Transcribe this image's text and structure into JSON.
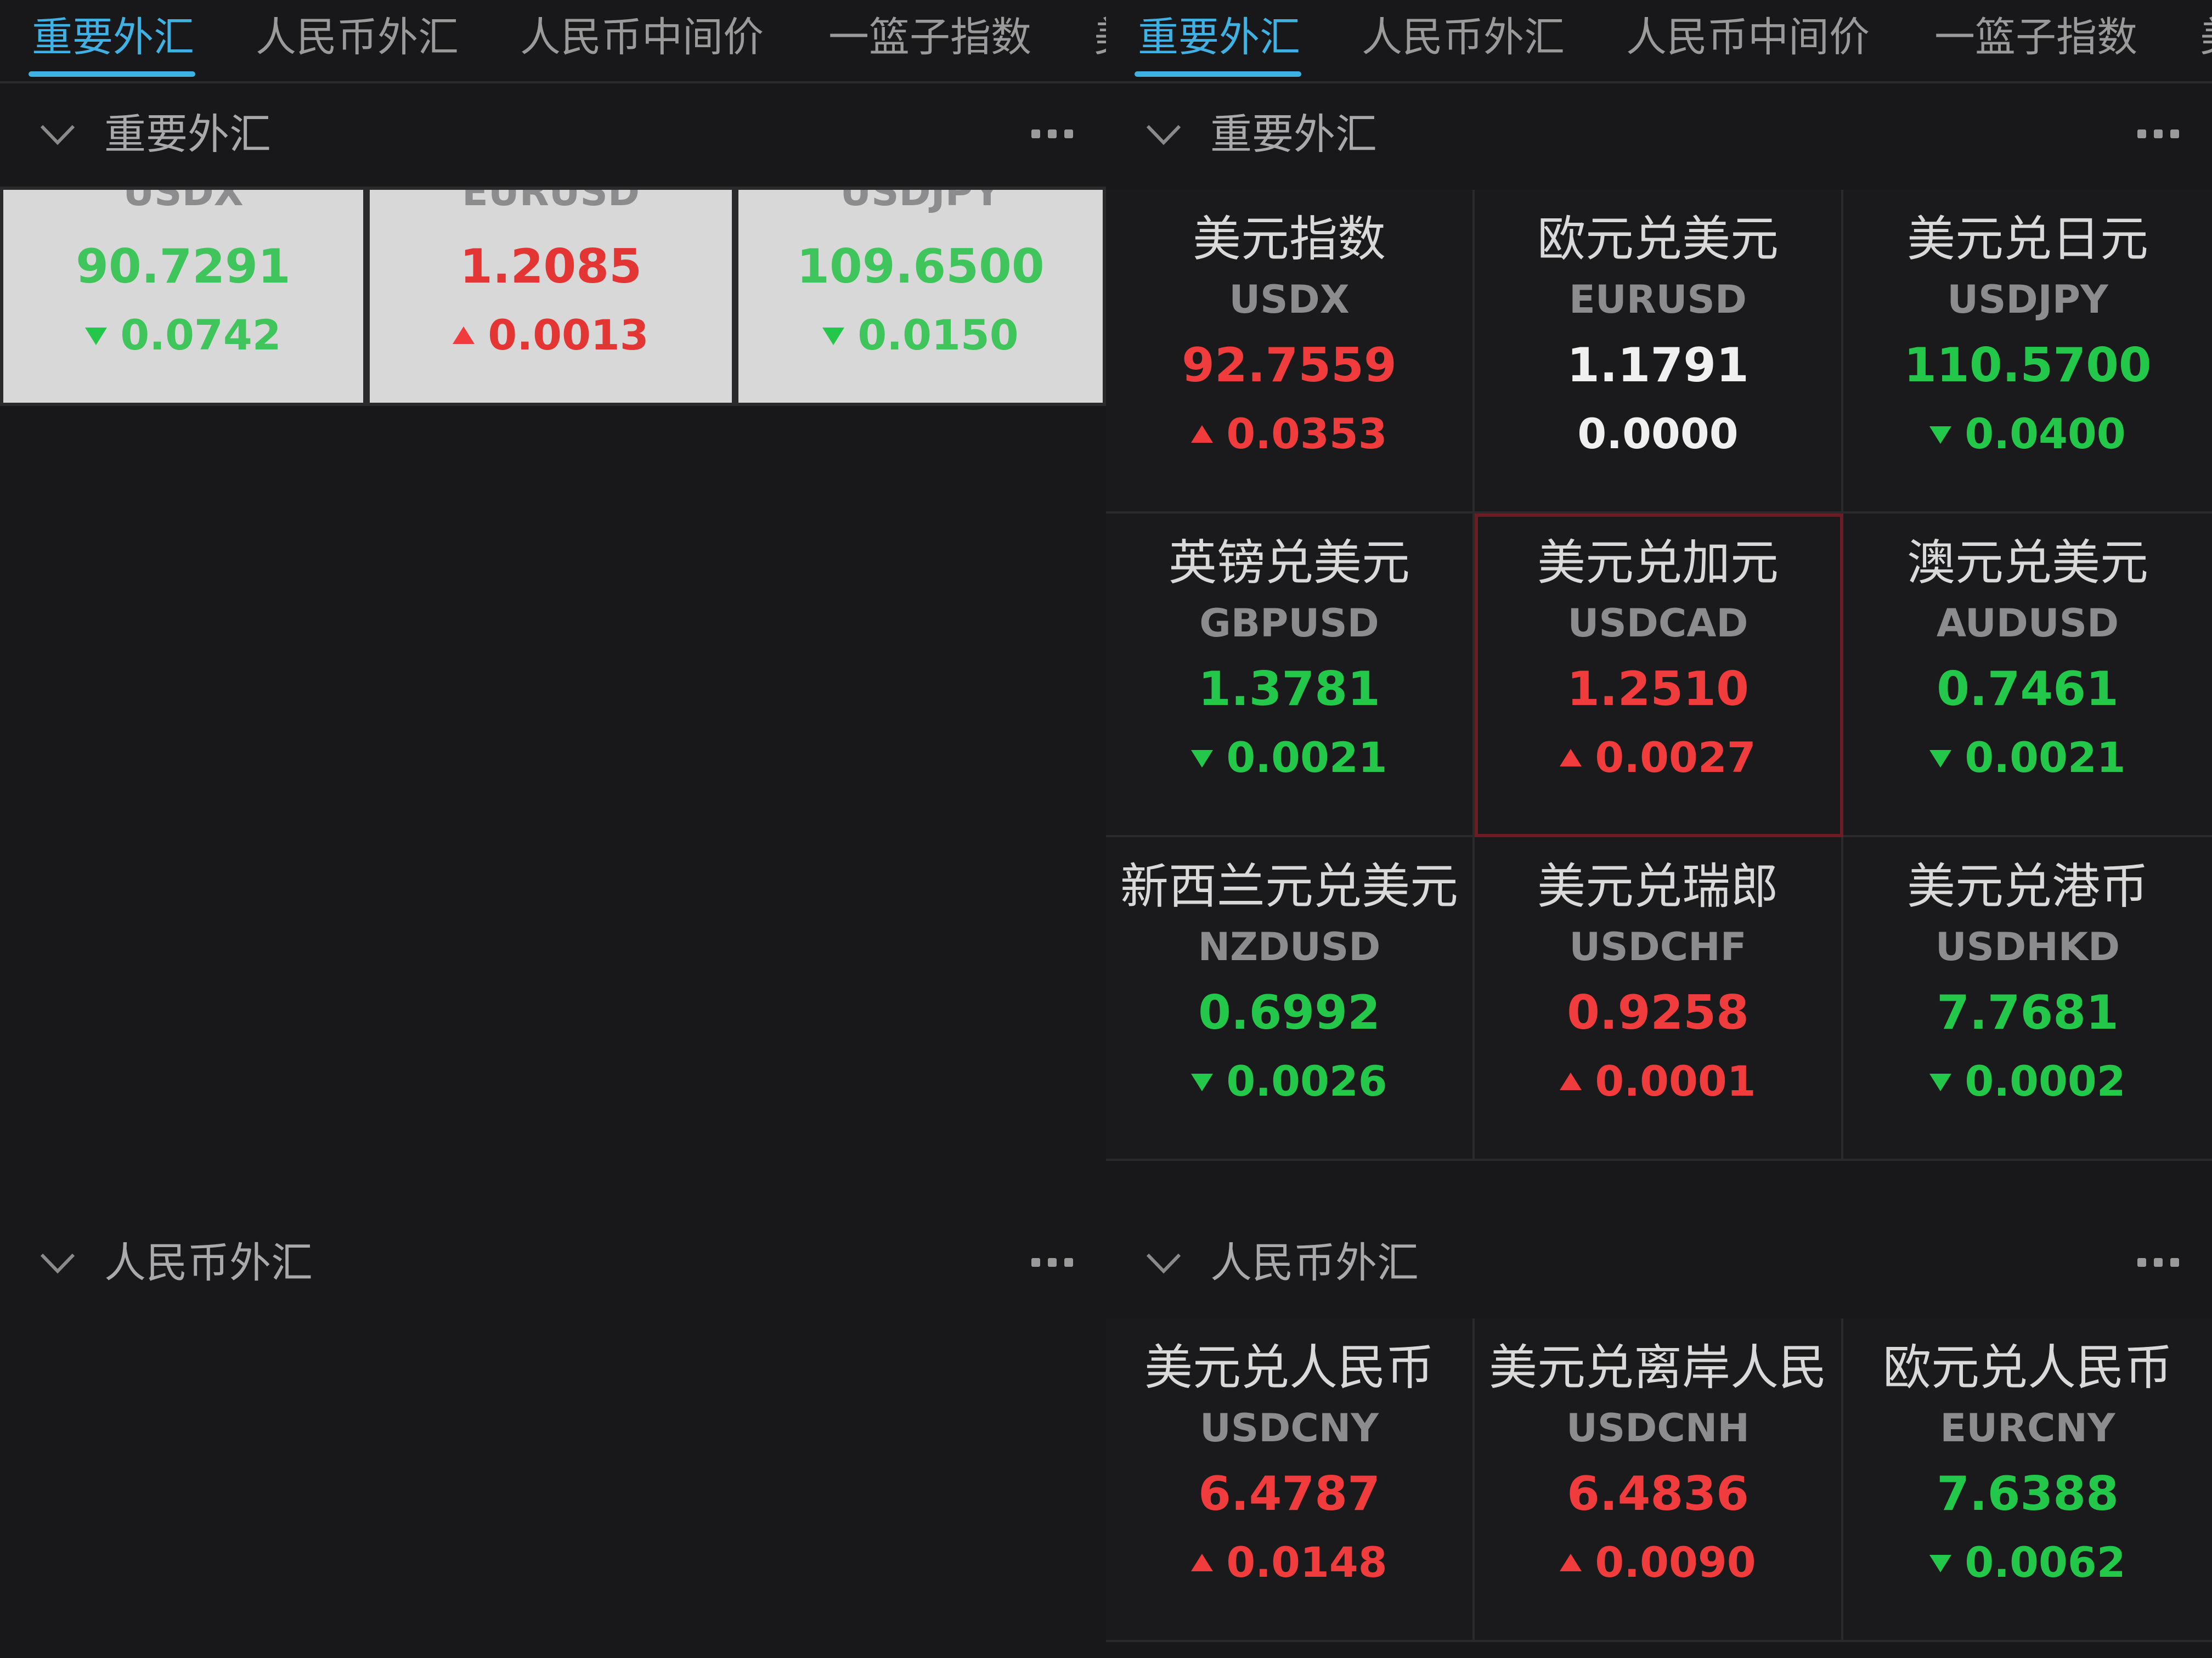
{
  "tabs": [
    "重要外汇",
    "人民币外汇",
    "人民币中间价",
    "一篮子指数"
  ],
  "tab_overflow_glyph": "美",
  "sections": {
    "major": "重要外汇",
    "rmb": "人民币外汇"
  },
  "left_scrolled": [
    {
      "code": "USDX",
      "price": "90.7291",
      "change": "0.0742",
      "direction": "down"
    },
    {
      "code": "EURUSD",
      "price": "1.2085",
      "change": "0.0013",
      "direction": "up"
    },
    {
      "code": "USDJPY",
      "price": "109.6500",
      "change": "0.0150",
      "direction": "down"
    }
  ],
  "major": [
    {
      "name": "美元指数",
      "code": "USDX",
      "price": "92.7559",
      "change": "0.0353",
      "direction": "up"
    },
    {
      "name": "欧元兑美元",
      "code": "EURUSD",
      "price": "1.1791",
      "change": "0.0000",
      "direction": "flat"
    },
    {
      "name": "美元兑日元",
      "code": "USDJPY",
      "price": "110.5700",
      "change": "0.0400",
      "direction": "down"
    },
    {
      "name": "英镑兑美元",
      "code": "GBPUSD",
      "price": "1.3781",
      "change": "0.0021",
      "direction": "down"
    },
    {
      "name": "美元兑加元",
      "code": "USDCAD",
      "price": "1.2510",
      "change": "0.0027",
      "direction": "up"
    },
    {
      "name": "澳元兑美元",
      "code": "AUDUSD",
      "price": "0.7461",
      "change": "0.0021",
      "direction": "down"
    },
    {
      "name": "新西兰元兑美元",
      "code": "NZDUSD",
      "price": "0.6992",
      "change": "0.0026",
      "direction": "down"
    },
    {
      "name": "美元兑瑞郎",
      "code": "USDCHF",
      "price": "0.9258",
      "change": "0.0001",
      "direction": "up"
    },
    {
      "name": "美元兑港币",
      "code": "USDHKD",
      "price": "7.7681",
      "change": "0.0002",
      "direction": "down"
    }
  ],
  "rmb": [
    {
      "name": "美元兑人民币",
      "code": "USDCNY",
      "price": "6.4787",
      "change": "0.0148",
      "direction": "up"
    },
    {
      "name": "美元兑离岸人民",
      "code": "USDCNH",
      "price": "6.4836",
      "change": "0.0090",
      "direction": "up"
    },
    {
      "name": "欧元兑人民币",
      "code": "EURCNY",
      "price": "7.6388",
      "change": "0.0062",
      "direction": "down"
    }
  ],
  "colors": {
    "up": "#f03c3c",
    "down": "#23c84a",
    "flat": "#f0f0f0",
    "accent": "#3fb2e3"
  },
  "icons": {
    "collapse": "chevron-down-icon",
    "more": "more-dots-icon",
    "up": "triangle-up-icon",
    "down": "triangle-down-icon"
  }
}
